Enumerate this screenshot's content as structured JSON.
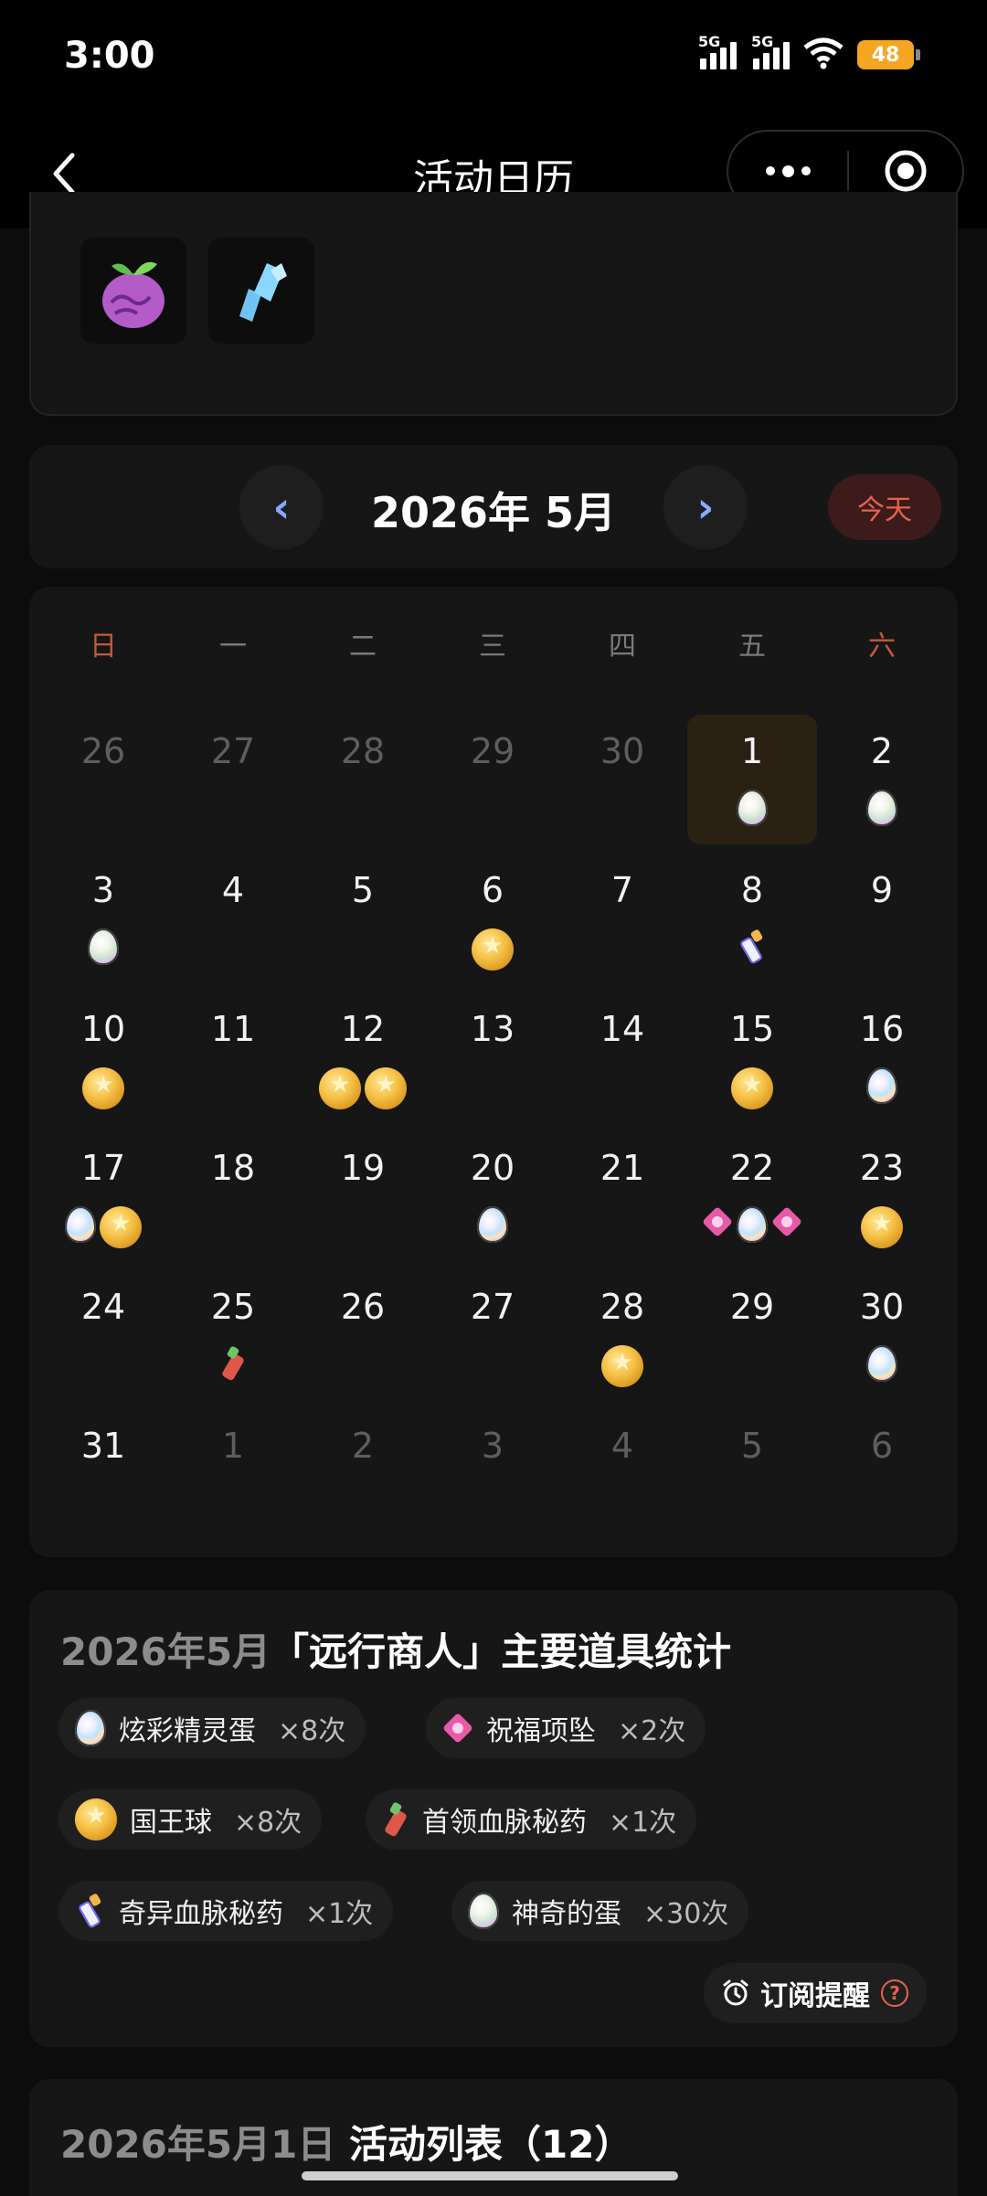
{
  "status_bar": {
    "time": "3:00",
    "network1": "5G",
    "network2": "5G",
    "battery": "48"
  },
  "nav": {
    "title": "活动日历",
    "back_icon": "chevron-left-icon",
    "more_icon": "more-dots-icon",
    "close_icon": "target-icon"
  },
  "top_rewards": [
    {
      "icon": "purple-fruit-icon"
    },
    {
      "icon": "blue-crystal-icon"
    }
  ],
  "month_header": {
    "prev": "‹",
    "title": "2026年 5月",
    "next": "›",
    "today": "今天"
  },
  "calendar": {
    "weekdays": [
      "日",
      "一",
      "二",
      "三",
      "四",
      "五",
      "六"
    ],
    "weeks": [
      [
        {
          "d": "26",
          "o": true,
          "i": []
        },
        {
          "d": "27",
          "o": true,
          "i": []
        },
        {
          "d": "28",
          "o": true,
          "i": []
        },
        {
          "d": "29",
          "o": true,
          "i": []
        },
        {
          "d": "30",
          "o": true,
          "i": []
        },
        {
          "d": "1",
          "s": true,
          "i": [
            "egg"
          ]
        },
        {
          "d": "2",
          "i": [
            "egg"
          ]
        }
      ],
      [
        {
          "d": "3",
          "i": [
            "egg"
          ]
        },
        {
          "d": "4",
          "i": []
        },
        {
          "d": "5",
          "i": []
        },
        {
          "d": "6",
          "i": [
            "ball"
          ]
        },
        {
          "d": "7",
          "i": []
        },
        {
          "d": "8",
          "i": [
            "potion2"
          ]
        },
        {
          "d": "9",
          "i": []
        }
      ],
      [
        {
          "d": "10",
          "i": [
            "ball"
          ]
        },
        {
          "d": "11",
          "i": []
        },
        {
          "d": "12",
          "i": [
            "ball",
            "ball"
          ]
        },
        {
          "d": "13",
          "i": []
        },
        {
          "d": "14",
          "i": []
        },
        {
          "d": "15",
          "i": [
            "ball"
          ]
        },
        {
          "d": "16",
          "i": [
            "rainbow"
          ]
        }
      ],
      [
        {
          "d": "17",
          "i": [
            "rainbow",
            "ball"
          ]
        },
        {
          "d": "18",
          "i": []
        },
        {
          "d": "19",
          "i": []
        },
        {
          "d": "20",
          "i": [
            "rainbow"
          ]
        },
        {
          "d": "21",
          "i": []
        },
        {
          "d": "22",
          "i": [
            "pend",
            "rainbow",
            "pend"
          ]
        },
        {
          "d": "23",
          "i": [
            "ball"
          ]
        }
      ],
      [
        {
          "d": "24",
          "i": []
        },
        {
          "d": "25",
          "i": [
            "potion"
          ]
        },
        {
          "d": "26",
          "i": []
        },
        {
          "d": "27",
          "i": []
        },
        {
          "d": "28",
          "i": [
            "ball"
          ]
        },
        {
          "d": "29",
          "i": []
        },
        {
          "d": "30",
          "i": [
            "rainbow"
          ]
        }
      ],
      [
        {
          "d": "31",
          "i": []
        },
        {
          "d": "1",
          "o": true,
          "i": []
        },
        {
          "d": "2",
          "o": true,
          "i": []
        },
        {
          "d": "3",
          "o": true,
          "i": []
        },
        {
          "d": "4",
          "o": true,
          "i": []
        },
        {
          "d": "5",
          "o": true,
          "i": []
        },
        {
          "d": "6",
          "o": true,
          "i": []
        }
      ]
    ]
  },
  "stats": {
    "title_date": "2026年5月",
    "title_main": "「远行商人」主要道具统计",
    "items": [
      {
        "icon": "rainbow",
        "name": "炫彩精灵蛋",
        "count": "×8次"
      },
      {
        "icon": "pend",
        "name": "祝福项坠",
        "count": "×2次"
      },
      {
        "icon": "ball",
        "name": "国王球",
        "count": "×8次"
      },
      {
        "icon": "potion",
        "name": "首领血脉秘药",
        "count": "×1次"
      },
      {
        "icon": "potion2",
        "name": "奇异血脉秘药",
        "count": "×1次"
      },
      {
        "icon": "egg",
        "name": "神奇的蛋",
        "count": "×30次"
      }
    ],
    "subscribe": "订阅提醒",
    "help": "?"
  },
  "activity_list": {
    "title_date": "2026年5月1日",
    "title_main": "活动列表（12）"
  }
}
